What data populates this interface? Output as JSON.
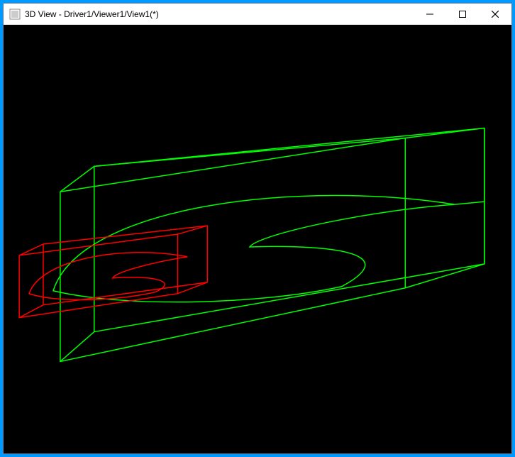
{
  "window": {
    "title": "3D View - Driver1/Viewer1/View1(*)",
    "icon": "app-icon"
  },
  "controls": {
    "minimize": "Minimize",
    "maximize": "Maximize",
    "close": "Close"
  },
  "viewport": {
    "background": "#000000",
    "objects": [
      {
        "name": "green-stock-box",
        "color": "#00ff00",
        "type": "wireframe-box"
      },
      {
        "name": "red-fixture-box",
        "color": "#ff0000",
        "type": "wireframe-box"
      },
      {
        "name": "green-toolpath",
        "color": "#00ff00",
        "type": "curve"
      },
      {
        "name": "red-toolpath",
        "color": "#ff0000",
        "type": "curve"
      }
    ]
  }
}
